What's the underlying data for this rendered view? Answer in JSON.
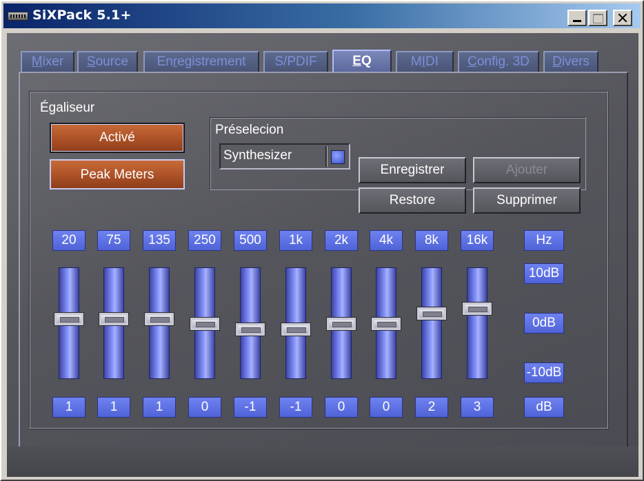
{
  "window": {
    "title": "SiXPack 5.1+",
    "controls": [
      "minimize",
      "maximize",
      "close"
    ]
  },
  "tabs": [
    {
      "label_pre": "",
      "label_ul": "M",
      "label_post": "ixer",
      "active": false
    },
    {
      "label_pre": "",
      "label_ul": "S",
      "label_post": "ource",
      "active": false
    },
    {
      "label_pre": "En",
      "label_ul": "r",
      "label_post": "egistrement",
      "active": false
    },
    {
      "label_pre": "S/PDIF",
      "label_ul": "",
      "label_post": "",
      "active": false
    },
    {
      "label_pre": "",
      "label_ul": "E",
      "label_post": "Q",
      "active": true
    },
    {
      "label_pre": "M",
      "label_ul": "I",
      "label_post": "DI",
      "active": false
    },
    {
      "label_pre": "",
      "label_ul": "C",
      "label_post": "onfig. 3D",
      "active": false
    },
    {
      "label_pre": "",
      "label_ul": "D",
      "label_post": "ivers",
      "active": false
    }
  ],
  "equalizer": {
    "group_label": "Égaliseur",
    "active_button": "Activé",
    "peak_meters_button": "Peak Meters",
    "preset": {
      "group_label": "Préselecion",
      "selected": "Synthesizer",
      "save_button": "Enregistrer",
      "restore_button": "Restore",
      "add_button": "Ajouter",
      "delete_button": "Supprimer"
    },
    "unit_hz": "Hz",
    "unit_db": "dB",
    "scale": {
      "top": "10dB",
      "middle": "0dB",
      "bottom": "-10dB"
    },
    "bands": [
      {
        "freq": "20",
        "value": "1"
      },
      {
        "freq": "75",
        "value": "1"
      },
      {
        "freq": "135",
        "value": "1"
      },
      {
        "freq": "250",
        "value": "0"
      },
      {
        "freq": "500",
        "value": "-1"
      },
      {
        "freq": "1k",
        "value": "-1"
      },
      {
        "freq": "2k",
        "value": "0"
      },
      {
        "freq": "4k",
        "value": "0"
      },
      {
        "freq": "8k",
        "value": "2"
      },
      {
        "freq": "16k",
        "value": "3"
      }
    ]
  }
}
